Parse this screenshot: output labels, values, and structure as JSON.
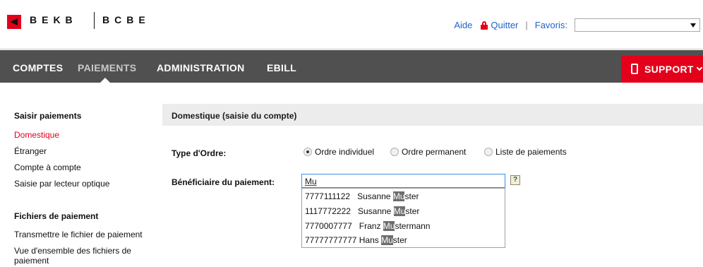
{
  "brand": {
    "name_de": "BEKB",
    "name_fr": "BCBE",
    "logo_icon": "bekb-logo-icon",
    "accent_color": "#e3001b"
  },
  "toplinks": {
    "help": "Aide",
    "logout": "Quitter",
    "favorites_label": "Favoris:",
    "favorites_value": ""
  },
  "nav": {
    "items": [
      "COMPTES",
      "PAIEMENTS",
      "ADMINISTRATION",
      "EBILL"
    ],
    "active": "PAIEMENTS",
    "support": "SUPPORT"
  },
  "sidebar": {
    "sections": [
      {
        "heading": "Saisir paiements",
        "items": [
          "Domestique",
          "Étranger",
          "Compte à compte",
          "Saisie par lecteur optique"
        ]
      },
      {
        "heading": "Fichiers de paiement",
        "items": [
          "Transmettre le fichier de paiement",
          "Vue d'ensemble des fichiers de",
          "paiement"
        ]
      }
    ],
    "active_item": "Domestique"
  },
  "content": {
    "title": "Domestique (saisie du compte)",
    "order_type_label": "Type d'Ordre:",
    "order_types": [
      {
        "label": "Ordre individuel",
        "checked": true
      },
      {
        "label": "Ordre permanent",
        "checked": false
      },
      {
        "label": "Liste de paiements",
        "checked": false
      }
    ],
    "beneficiary_label": "Bénéficiaire du paiement:",
    "beneficiary_value": "Mu",
    "help_symbol": "?",
    "suggestions": [
      {
        "account": "7777111122",
        "pre": "Susanne ",
        "match": "Mu",
        "post": "ster"
      },
      {
        "account": "1117772222",
        "pre": "Susanne ",
        "match": "Mu",
        "post": "ster"
      },
      {
        "account": "7770007777",
        "pre": "Franz ",
        "match": "Mu",
        "post": "stermann"
      },
      {
        "account": "77777777777",
        "pre": "Hans ",
        "match": "Mu",
        "post": "ster"
      }
    ]
  }
}
